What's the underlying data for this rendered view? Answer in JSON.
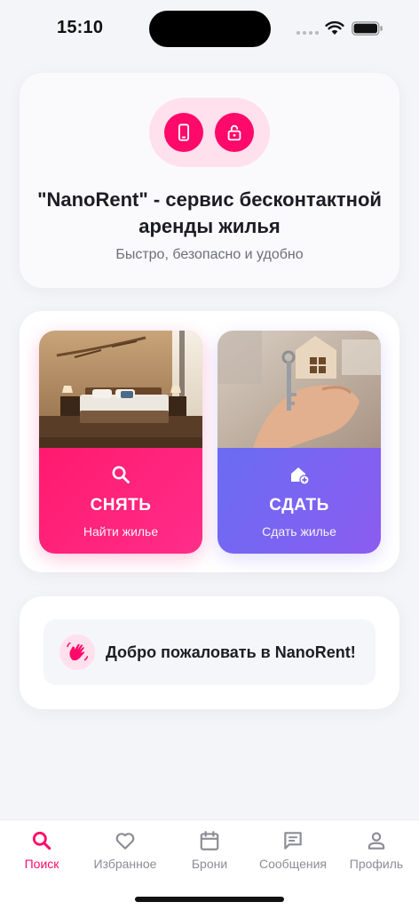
{
  "status_bar": {
    "time": "15:10"
  },
  "hero": {
    "title": "\"NanoRent\" - сервис бесконтактной аренды жилья",
    "subtitle": "Быстро, безопасно и удобно",
    "icons": [
      "smartphone-icon",
      "unlock-icon"
    ]
  },
  "actions": [
    {
      "title": "СНЯТЬ",
      "subtitle": "Найти жилье",
      "icon": "search-icon",
      "image": "bedroom-photo"
    },
    {
      "title": "СДАТЬ",
      "subtitle": "Сдать жилье",
      "icon": "home-add-icon",
      "image": "house-keys-photo"
    }
  ],
  "welcome": {
    "text": "Добро пожаловать в NanoRent!",
    "icon": "waving-hand-icon"
  },
  "tabbar": {
    "items": [
      {
        "label": "Поиск",
        "icon": "search-icon",
        "active": true
      },
      {
        "label": "Избранное",
        "icon": "heart-icon",
        "active": false
      },
      {
        "label": "Брони",
        "icon": "calendar-icon",
        "active": false
      },
      {
        "label": "Сообщения",
        "icon": "chat-icon",
        "active": false
      },
      {
        "label": "Профиль",
        "icon": "person-icon",
        "active": false
      }
    ]
  },
  "colors": {
    "accent": "#ff0a6a",
    "accent_soft": "#ffe0ec",
    "lease_gradient_start": "#6a6cf2",
    "lease_gradient_end": "#8b5cf0",
    "inactive": "#8c8d94"
  }
}
